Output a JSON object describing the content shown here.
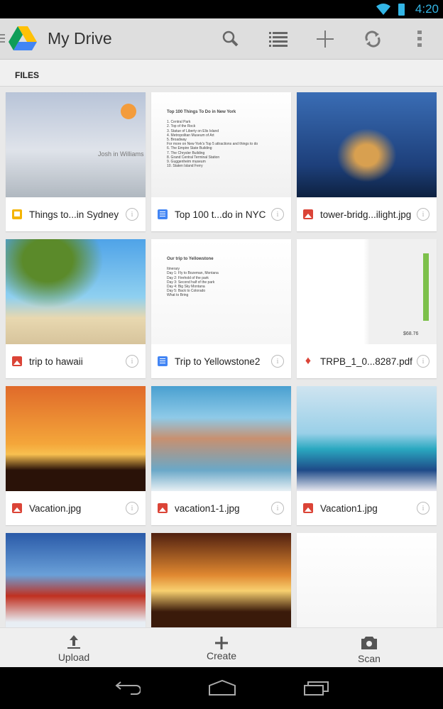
{
  "status_bar": {
    "time": "4:20"
  },
  "action_bar": {
    "title": "My Drive",
    "actions": [
      "search",
      "view-list",
      "add",
      "refresh",
      "overflow-menu"
    ]
  },
  "tabs": {
    "files": "FILES"
  },
  "files": [
    {
      "name": "Things to...in Sydney",
      "type": "slides",
      "thumb_text": "Josh in Williams"
    },
    {
      "name": "Top 100 t...do in NYC",
      "type": "doc",
      "thumb_title": "Top 100 Things To Do in New York",
      "thumb_lines": [
        "1. Central Park",
        "2. Top of the Rock",
        "3. Statue of Liberty on Elis Island",
        "4. Metropolitan Museum of Art",
        "5. Broadway",
        "For more on New York's Top 5 attractions and things to do",
        "6. The Empire State Building",
        "7. The Chrysler Building",
        "8. Grand Central Terminal Station",
        "9. Guggenheim museum",
        "10. Staten Island Ferry"
      ]
    },
    {
      "name": "tower-bridg...ilight.jpg",
      "type": "image"
    },
    {
      "name": "trip to hawaii",
      "type": "image"
    },
    {
      "name": "Trip to Yellowstone2",
      "type": "doc",
      "thumb_title": "Our trip to Yellowstone",
      "thumb_lines": [
        "Itinerary",
        "Day 1: Fly to Bozeman, Montana",
        "Day 2: Firehold of the park",
        "Day 3: Second half of the park",
        "Day 4: Big Sky Montana",
        "Day 5: Back to Colorado",
        "What to Bring"
      ]
    },
    {
      "name": "TRPB_1_0...8287.pdf",
      "type": "pdf",
      "thumb_total": "$68.76"
    },
    {
      "name": "Vacation.jpg",
      "type": "image"
    },
    {
      "name": "vacation1-1.jpg",
      "type": "image"
    },
    {
      "name": "Vacation1.jpg",
      "type": "image"
    },
    {
      "name": "",
      "type": "image"
    },
    {
      "name": "",
      "type": "image"
    },
    {
      "name": "",
      "type": "image"
    }
  ],
  "bottom_bar": {
    "upload": "Upload",
    "create": "Create",
    "scan": "Scan"
  },
  "colors": {
    "accent": "#33b5e5",
    "slides": "#f4b400",
    "doc": "#4285f4",
    "image": "#db4437"
  }
}
